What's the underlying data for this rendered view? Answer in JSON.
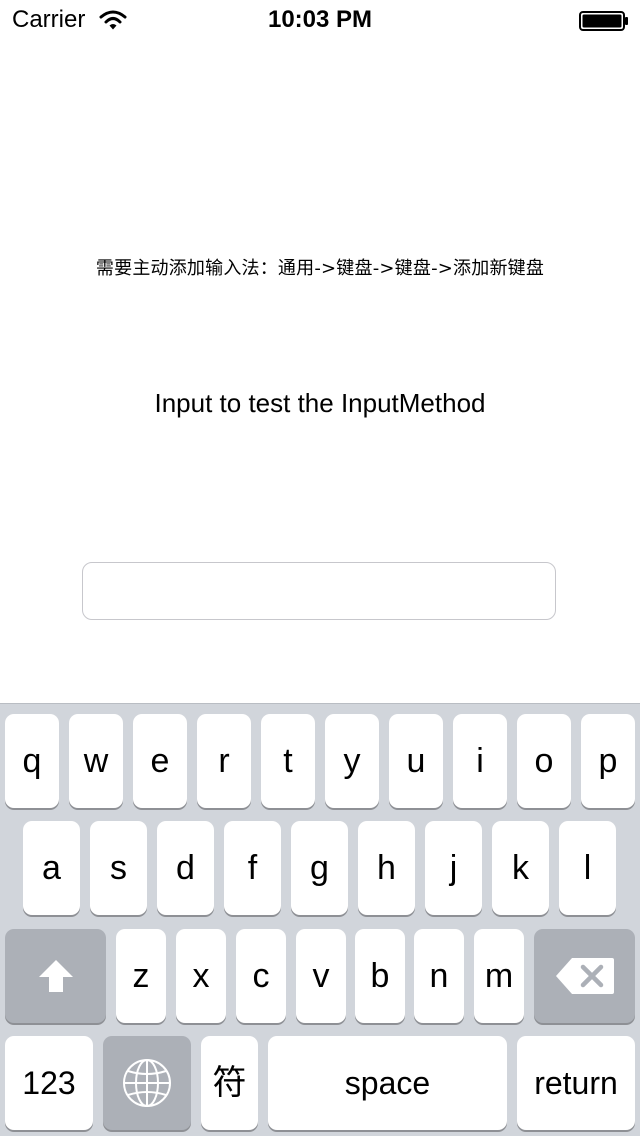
{
  "status_bar": {
    "carrier": "Carrier",
    "time": "10:03 PM"
  },
  "content": {
    "hint": "需要主动添加输入法：通用->键盘->键盘->添加新键盘",
    "title": "Input to test the InputMethod",
    "input_value": ""
  },
  "keyboard": {
    "row1": [
      "q",
      "w",
      "e",
      "r",
      "t",
      "y",
      "u",
      "i",
      "o",
      "p"
    ],
    "row2": [
      "a",
      "s",
      "d",
      "f",
      "g",
      "h",
      "j",
      "k",
      "l"
    ],
    "row3": [
      "z",
      "x",
      "c",
      "v",
      "b",
      "n",
      "m"
    ],
    "numbers_label": "123",
    "symbol_label": "符",
    "space_label": "space",
    "return_label": "return"
  },
  "colors": {
    "keyboard_bg": "#d1d5db",
    "key_bg": "#ffffff",
    "dark_key_bg": "#acb0b7"
  },
  "icons": {
    "wifi": "wifi-icon",
    "battery": "battery-icon",
    "shift": "shift-arrow-icon",
    "delete": "backspace-icon",
    "globe": "globe-icon"
  }
}
